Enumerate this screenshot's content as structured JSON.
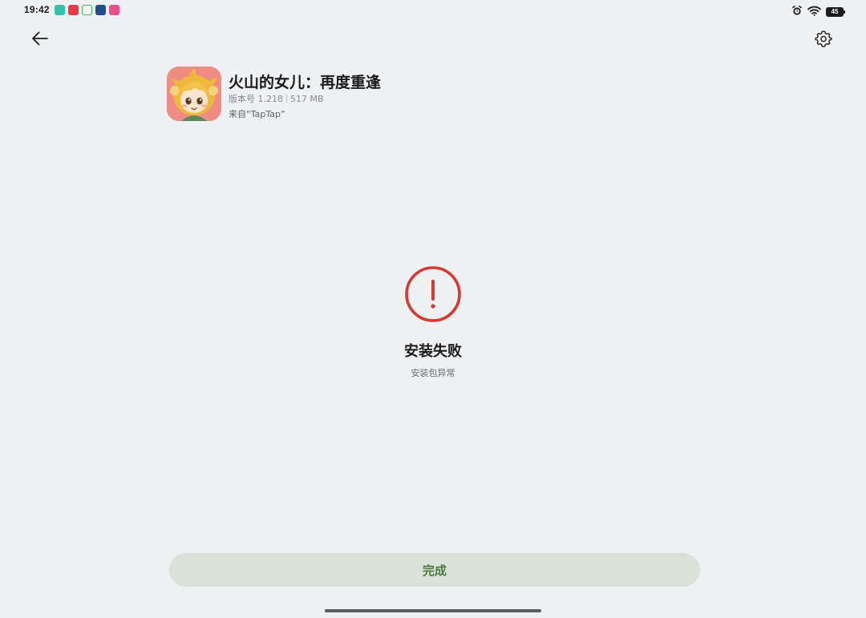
{
  "status_bar": {
    "time": "19:42",
    "battery_level": "45",
    "notification_icons": [
      {
        "name": "chat-app-icon",
        "color": "#35c2a8"
      },
      {
        "name": "red-app-icon",
        "color": "#e93a45"
      },
      {
        "name": "green-app-icon",
        "color": "#47b36a"
      },
      {
        "name": "blue-app-icon",
        "color": "#1f4e8c"
      },
      {
        "name": "pink-app-icon",
        "color": "#e54f8a"
      }
    ]
  },
  "header": {
    "back_icon": "arrow-left-icon",
    "settings_icon": "gear-icon"
  },
  "app": {
    "name": "火山的女儿：再度重逢",
    "version": "版本号 1.218",
    "size": "517 MB",
    "source": "来自“TapTap”",
    "icon_background": "#ef8d85"
  },
  "install_status": {
    "icon": "error-exclamation-icon",
    "icon_color": "#d33b32",
    "title": "安装失败",
    "subtitle": "安装包异常"
  },
  "actions": {
    "done_label": "完成",
    "done_color": "#4c7a3f",
    "done_background": "#d9e1d9"
  }
}
